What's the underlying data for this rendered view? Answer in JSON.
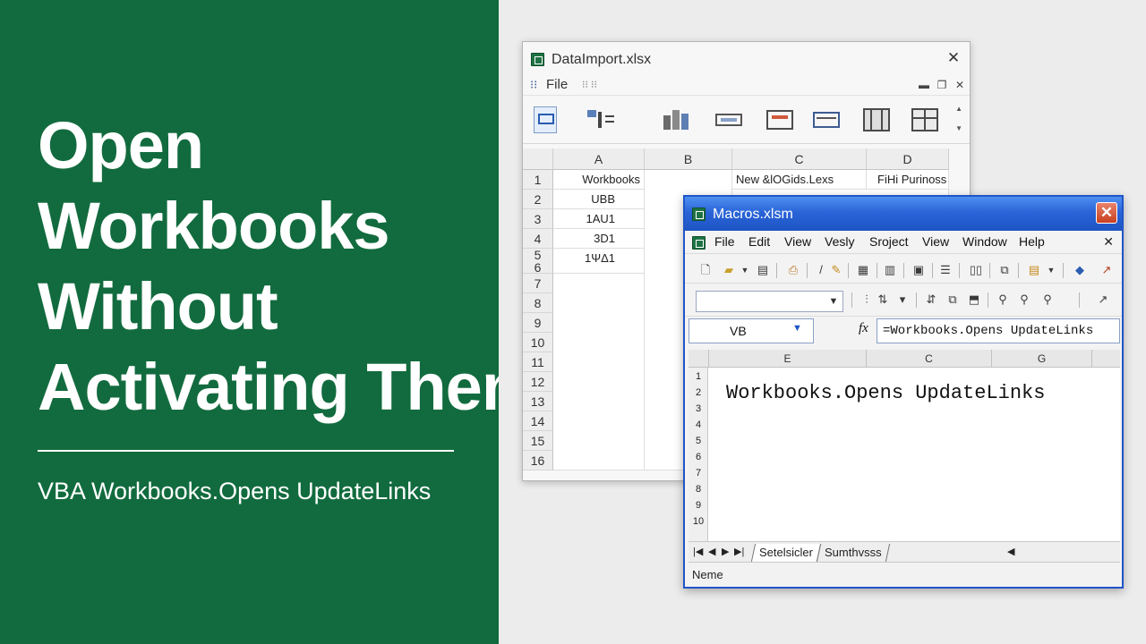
{
  "headline": {
    "line1": "Open",
    "line2": "Workbooks",
    "line3": "Without",
    "line4": "Activating Them"
  },
  "subtitle": "VBA Workbooks.Opens UpdateLinks",
  "colors": {
    "brand_green": "#126b3e",
    "background": "#ececec",
    "front_title_blue": "#2a64d8",
    "close_red": "#d0482a"
  },
  "back_window": {
    "title": "DataImport.xlsx",
    "menu": {
      "file": "File",
      "menu_glyph": "⁝⁝",
      "small_labels": "⁝⁝  ⁝⁝"
    },
    "columns": [
      "A",
      "B",
      "C",
      "D"
    ],
    "row_numbers": [
      "1",
      "2",
      "3",
      "4",
      "5",
      "6",
      "7",
      "8",
      "9",
      "10",
      "11",
      "12",
      "13",
      "14",
      "15",
      "16"
    ],
    "cells": {
      "A1": "Workbooks",
      "A2": "UBB",
      "A3": "1AU1",
      "A4": "3D1",
      "A5": "1ΨΔ1",
      "C1": "New &lOGids.Lexs",
      "D1": "FiHi Purinoss"
    },
    "icons": [
      "select-icon",
      "format-painter-icon",
      "chart-icon",
      "table-icon",
      "insert-icon",
      "align-icon",
      "grid-icon",
      "freeze-icon"
    ]
  },
  "front_window": {
    "title": "Macros.xlsm",
    "menu": [
      "File",
      "Edit",
      "View",
      "Vesly",
      "Sroject",
      "View",
      "Window",
      "Help"
    ],
    "name_box": "VB",
    "fx": "fx",
    "formula": "=Workbooks.Opens UpdateLinks",
    "columns": [
      "E",
      "C",
      "G"
    ],
    "row_numbers": [
      "1",
      "2",
      "3",
      "4",
      "5",
      "6",
      "7",
      "8",
      "9",
      "10"
    ],
    "code": "Workbooks.Opens UpdateLinks",
    "sheet_tabs": [
      "Setelsicler",
      "Sumthvsss"
    ],
    "status": "Neme"
  }
}
